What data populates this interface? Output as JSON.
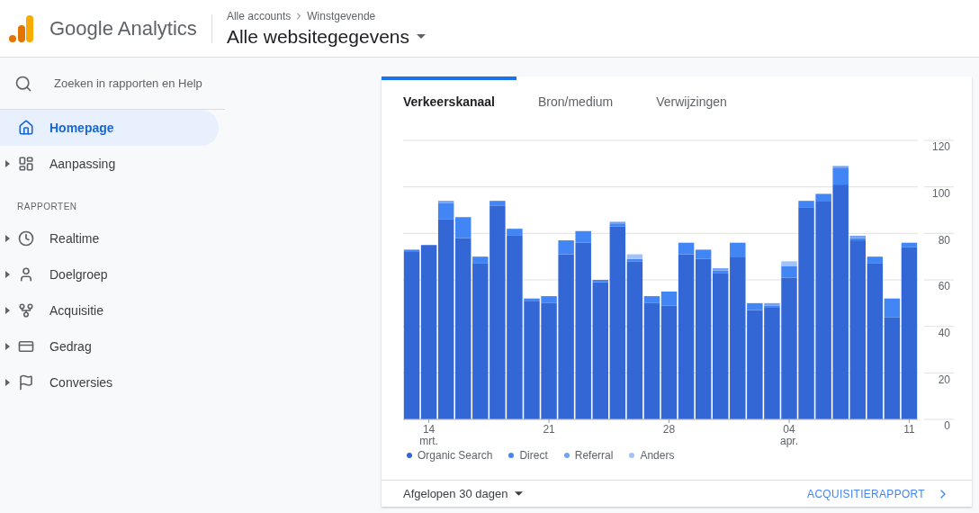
{
  "header": {
    "product": "Google Analytics",
    "breadcrumb": [
      "Alle accounts",
      "Winstgevende"
    ],
    "view": "Alle websitegegevens"
  },
  "sidebar": {
    "search": {
      "placeholder": "Zoeken in rapporten en Help"
    },
    "top_items": [
      {
        "label": "Homepage",
        "selected": true,
        "expandable": false
      },
      {
        "label": "Aanpassing",
        "selected": false,
        "expandable": true
      }
    ],
    "section": "RAPPORTEN",
    "items": [
      {
        "label": "Realtime",
        "selected": false,
        "expandable": true
      },
      {
        "label": "Doelgroep",
        "selected": false,
        "expandable": true
      },
      {
        "label": "Acquisitie",
        "selected": false,
        "expandable": true
      },
      {
        "label": "Gedrag",
        "selected": false,
        "expandable": true
      },
      {
        "label": "Conversies",
        "selected": false,
        "expandable": true
      }
    ]
  },
  "card": {
    "tabs": [
      {
        "label": "Verkeerskanaal",
        "selected": true
      },
      {
        "label": "Bron/medium",
        "selected": false
      },
      {
        "label": "Verwijzingen",
        "selected": false
      }
    ],
    "chart_data": {
      "type": "bar",
      "stacked": true,
      "categories": [
        null,
        "14 mrt.",
        null,
        null,
        null,
        null,
        null,
        null,
        "21",
        null,
        null,
        null,
        null,
        null,
        null,
        "28",
        null,
        null,
        null,
        null,
        null,
        null,
        "04 apr.",
        null,
        null,
        null,
        null,
        null,
        null,
        "11"
      ],
      "series": [
        {
          "name": "Organic Search",
          "color": "#3367d6",
          "values": [
            72,
            75,
            86,
            78,
            67,
            92,
            79,
            51,
            50,
            71,
            76,
            59,
            83,
            68,
            50,
            49,
            71,
            69,
            63,
            70,
            47,
            48,
            61,
            91,
            94,
            101,
            77,
            67,
            44,
            74
          ]
        },
        {
          "name": "Direct",
          "color": "#4285f4",
          "values": [
            1,
            0,
            7,
            9,
            3,
            2,
            3,
            1,
            3,
            6,
            5,
            1,
            1,
            1,
            3,
            6,
            5,
            4,
            1,
            6,
            3,
            1,
            5,
            3,
            3,
            7,
            1,
            3,
            8,
            2
          ]
        },
        {
          "name": "Referral",
          "color": "#72a1f7",
          "values": [
            0,
            0,
            1,
            0,
            0,
            0,
            0,
            0,
            0,
            0,
            0,
            0,
            1,
            0,
            0,
            0,
            0,
            0,
            1,
            0,
            0,
            1,
            0,
            0,
            0,
            1,
            1,
            0,
            0,
            0
          ]
        },
        {
          "name": "Anders",
          "color": "#a1c2fa",
          "values": [
            0,
            0,
            0,
            0,
            0,
            0,
            0,
            0,
            0,
            0,
            0,
            0,
            0,
            2,
            0,
            0,
            0,
            0,
            0,
            0,
            0,
            0,
            2,
            0,
            0,
            0,
            0,
            0,
            0,
            0
          ]
        }
      ],
      "grid": true,
      "ylim": [
        0,
        120
      ],
      "yticks": [
        0,
        20,
        40,
        60,
        80,
        100,
        120
      ]
    },
    "period": "Afgelopen 30 dagen",
    "report_link": "ACQUISITIERAPPORT"
  }
}
